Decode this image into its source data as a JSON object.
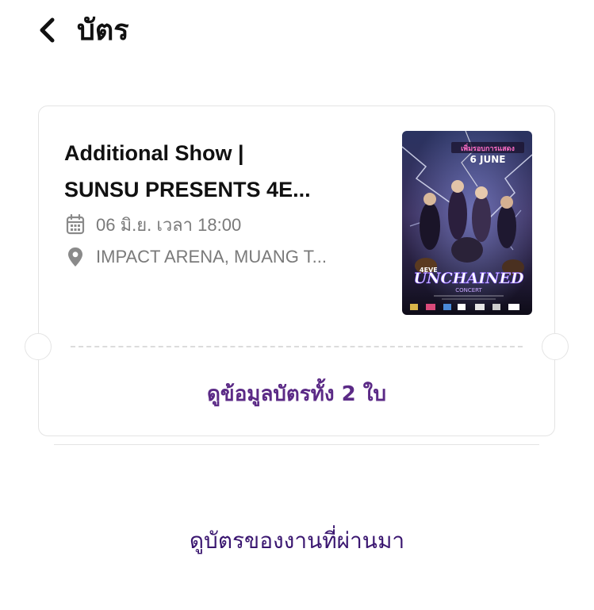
{
  "header": {
    "title": "บัตร"
  },
  "ticket": {
    "title_line1": "Additional Show |",
    "title_line2": "SUNSU PRESENTS 4E...",
    "datetime": "06 มิ.ย. เวลา 18:00",
    "venue": "IMPACT ARENA, MUANG T...",
    "view_tickets_label": "ดูข้อมูลบัตรทั้ง 2 ใบ",
    "poster": {
      "badge_text": "เพิ่มรอบการแสดง",
      "date_text": "6 JUNE",
      "logo_prefix": "4EVE",
      "logo_text": "UNCHAINED",
      "logo_sub": "CONCERT"
    }
  },
  "footer": {
    "past_events_label": "ดูบัตรของงานที่ผ่านมา"
  },
  "colors": {
    "accent": "#5b2a86",
    "link": "#3a1670",
    "muted": "#7a7a7a",
    "border": "#e4e4e4"
  },
  "icons": {
    "back": "chevron-left-icon",
    "date": "calendar-icon",
    "venue": "map-pin-icon"
  }
}
